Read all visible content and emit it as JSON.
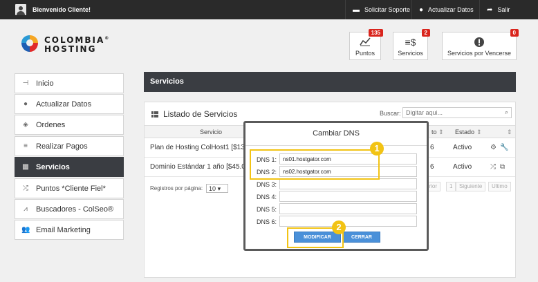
{
  "topbar": {
    "welcome": "Bienvenido Cliente!",
    "support": "Solicitar Soporte",
    "update": "Actualizar Datos",
    "logout": "Salir"
  },
  "logo": {
    "line1": "COLOMBIA",
    "line2": "HOSTING",
    "reg": "®"
  },
  "stats": [
    {
      "label": "Puntos",
      "badge": "135",
      "icon": "chart-icon"
    },
    {
      "label": "Servicios",
      "badge": "2",
      "icon": "coins-icon"
    },
    {
      "label": "Servicios por Vencerse",
      "badge": "0",
      "icon": "alert-icon"
    }
  ],
  "sidebar": {
    "items": [
      {
        "label": "Inicio",
        "icon": "plug-icon"
      },
      {
        "label": "Actualizar Datos",
        "icon": "user-icon"
      },
      {
        "label": "Ordenes",
        "icon": "tag-icon"
      },
      {
        "label": "Realizar Pagos",
        "icon": "coins-icon"
      },
      {
        "label": "Servicios",
        "icon": "grid-icon",
        "active": true
      },
      {
        "label": "Puntos *Cliente Fiel*",
        "icon": "shuffle-icon"
      },
      {
        "label": "Buscadores - ColSeo®",
        "icon": "chart-icon"
      },
      {
        "label": "Email Marketing",
        "icon": "users-icon"
      }
    ]
  },
  "content": {
    "header": "Servicios",
    "panel_title": "Listado de Servicios",
    "search_label": "Buscar:",
    "search_placeholder": "Digitar aqui...",
    "columns": {
      "service": "Servicio",
      "date_partial": "to",
      "status": "Estado"
    },
    "rows": [
      {
        "service": "Plan de Hosting ColHost1 [$135.00",
        "date_partial": "6",
        "status": "Activo"
      },
      {
        "service": "Dominio Estándar 1 año [$45.000,0",
        "date_partial": "6",
        "status": "Activo"
      }
    ],
    "per_page_label": "Registros por página:",
    "per_page_value": "10",
    "pager": {
      "prev": "erior",
      "page": "1",
      "next": "Siguiente",
      "last": "Ultimo"
    }
  },
  "modal": {
    "title": "Cambiar DNS",
    "fields": [
      {
        "label": "DNS 1:",
        "value": "ns01.hostgator.com"
      },
      {
        "label": "DNS 2:",
        "value": "ns02.hostgator.com"
      },
      {
        "label": "DNS 3:",
        "value": ""
      },
      {
        "label": "DNS 4:",
        "value": ""
      },
      {
        "label": "DNS 5:",
        "value": ""
      },
      {
        "label": "DNS 6:",
        "value": ""
      }
    ],
    "modify": "MODIFICAR",
    "close": "CERRAR",
    "callout1": "1",
    "callout2": "2"
  },
  "colors": {
    "topbar": "#2a2a2a",
    "active": "#3a3d42",
    "badge": "#d9251d",
    "highlight": "#f2c314",
    "button": "#4a90d9"
  }
}
